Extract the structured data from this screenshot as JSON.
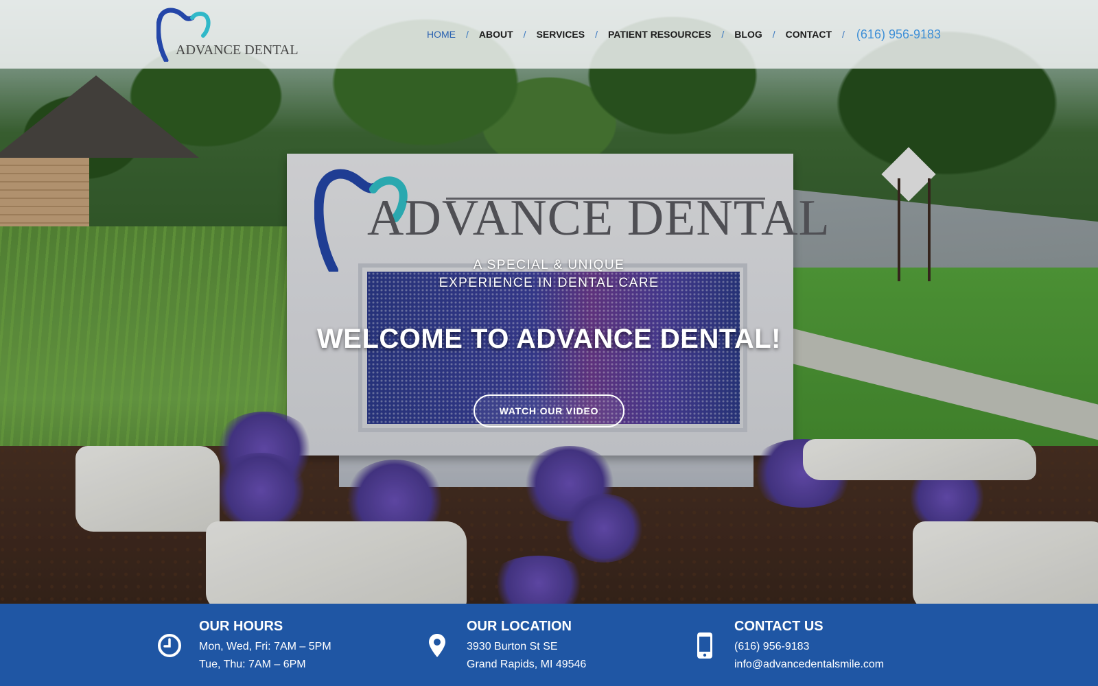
{
  "brand": {
    "logo_text": "ADVANCE DENTAL",
    "accent_blue": "#2a62b0",
    "accent_teal": "#2ab6c6",
    "bar_blue": "#1f56a4"
  },
  "nav": {
    "items": [
      {
        "label": "HOME",
        "active": true
      },
      {
        "label": "ABOUT"
      },
      {
        "label": "SERVICES"
      },
      {
        "label": "PATIENT RESOURCES"
      },
      {
        "label": "BLOG"
      },
      {
        "label": "CONTACT"
      }
    ],
    "separator": "/",
    "phone": "(616) 956-9183"
  },
  "hero": {
    "tagline_line1": "A SPECIAL & UNIQUE",
    "tagline_line2": "EXPERIENCE IN DENTAL CARE",
    "title": "WELCOME TO ADVANCE DENTAL!",
    "button_label": "WATCH OUR VIDEO",
    "sign_text": "ADVANCE DENTAL"
  },
  "info": {
    "hours": {
      "icon": "clock-icon",
      "title": "OUR HOURS",
      "line1": "Mon, Wed, Fri: 7AM – 5PM",
      "line2": "Tue, Thu: 7AM – 6PM"
    },
    "location": {
      "icon": "map-pin-icon",
      "title": "OUR LOCATION",
      "line1": "3930 Burton St SE",
      "line2": "Grand Rapids, MI 49546"
    },
    "contact": {
      "icon": "phone-icon",
      "title": "CONTACT US",
      "line1": "(616) 956-9183",
      "line2": "info@advancedentalsmile.com"
    }
  }
}
